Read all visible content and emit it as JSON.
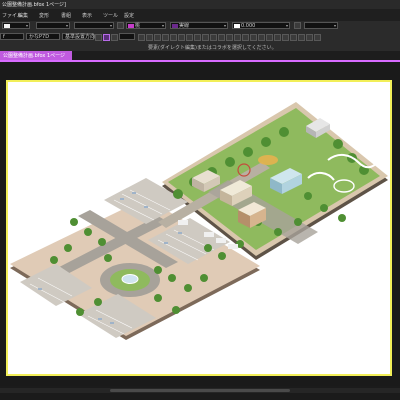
{
  "window": {
    "title": "公園整備計画.bfox 1ページ]"
  },
  "menu": [
    "ファイル",
    "編集",
    "変形",
    "書組",
    "表示",
    "ツール",
    "設定"
  ],
  "toolbar1": {
    "stroke_color": "#f2f2f2",
    "fill_label": "桃",
    "fill_color": "#c43cc8",
    "style_label": "実線",
    "style_color": "#6b2a8c",
    "width_label": "0.000",
    "width_color": "#ffffff"
  },
  "toolbar2": {
    "left_label": "f",
    "font_label": "かなP7D",
    "size_label": "基準設置方向",
    "hint": "要素(ダイレクト編集)またはコラボを選択してください。"
  },
  "tab": {
    "label": "公園整備計画.bfox 1ページ"
  },
  "colors": {
    "accent": "#d86bff",
    "page_border": "#f2ef58",
    "ground": "#e0cbb6",
    "road": "#a7a29a",
    "grass": "#8fba5e",
    "tree": "#4f8f33"
  }
}
